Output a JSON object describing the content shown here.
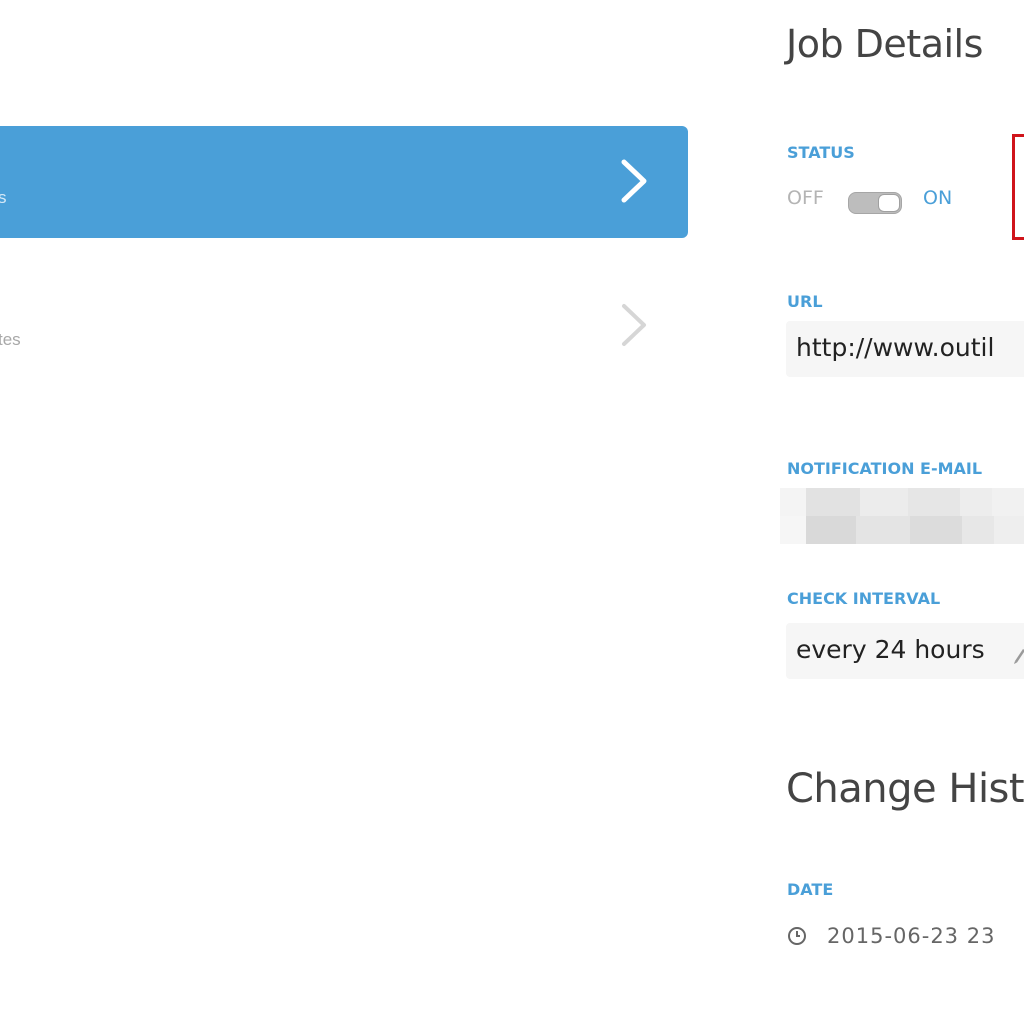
{
  "job_list": {
    "items": [
      {
        "subtitle": "s",
        "active": true
      },
      {
        "subtitle": "tes",
        "active": false
      }
    ]
  },
  "details": {
    "title": "Job Details",
    "status": {
      "label": "STATUS",
      "off_label": "OFF",
      "on_label": "ON",
      "value": "on"
    },
    "url": {
      "label": "URL",
      "value": "http://www.outil"
    },
    "notification_email": {
      "label": "NOTIFICATION E-MAIL"
    },
    "check_interval": {
      "label": "CHECK INTERVAL",
      "value": "every 24 hours"
    }
  },
  "history": {
    "title": "Change Histo",
    "date_label": "DATE",
    "first_date": "2015-06-23 23"
  },
  "colors": {
    "accent": "#4a9fd8",
    "highlight_frame": "#d0141b"
  },
  "icons": {
    "job_chevron": "chevron-right-icon",
    "edit": "pencil-icon",
    "date": "clock-icon"
  }
}
